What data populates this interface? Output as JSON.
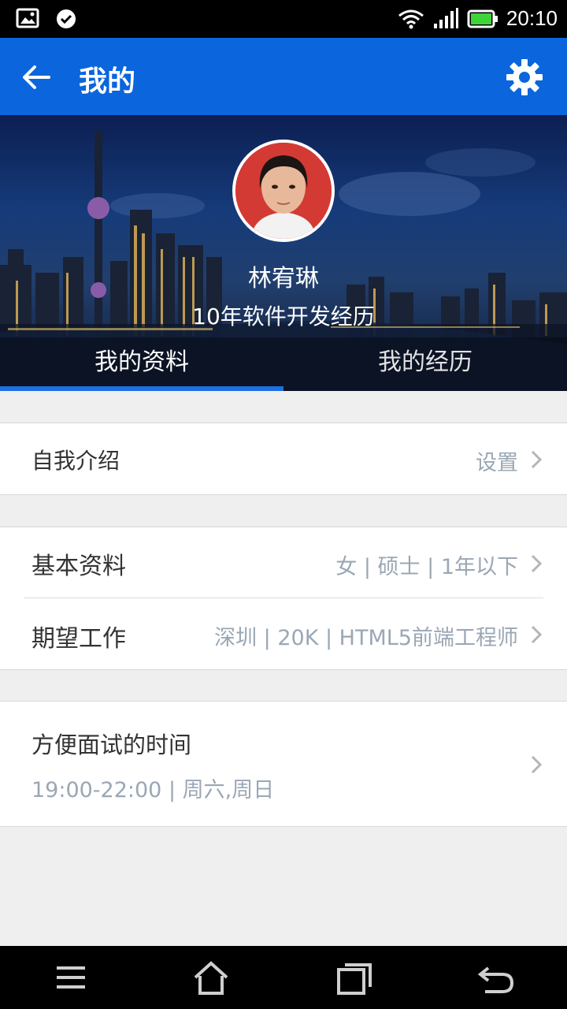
{
  "status_bar": {
    "time": "20:10",
    "icons": [
      "image-icon",
      "check-circle-icon",
      "wifi-icon",
      "signal-icon",
      "battery-icon"
    ],
    "battery_color": "#3fd43a"
  },
  "app_bar": {
    "title": "我的",
    "background_color": "#0b65dd"
  },
  "profile": {
    "name": "林宥琳",
    "experience": "10年软件开发经历"
  },
  "tabs": [
    {
      "label": "我的资料",
      "active": true
    },
    {
      "label": "我的经历",
      "active": false
    }
  ],
  "sections": {
    "intro": {
      "label": "自我介绍",
      "value": "设置"
    },
    "basic": {
      "label": "基本资料",
      "value": "女 | 硕士 | 1年以下"
    },
    "expect": {
      "label": "期望工作",
      "value": "深圳 | 20K | HTML5前端工程师"
    },
    "interview": {
      "label": "方便面试的时间",
      "value": "19:00-22:00 | 周六,周日"
    }
  },
  "nav_bar": {
    "buttons": [
      "menu-icon",
      "home-icon",
      "recents-icon",
      "back-arrow-icon"
    ]
  }
}
